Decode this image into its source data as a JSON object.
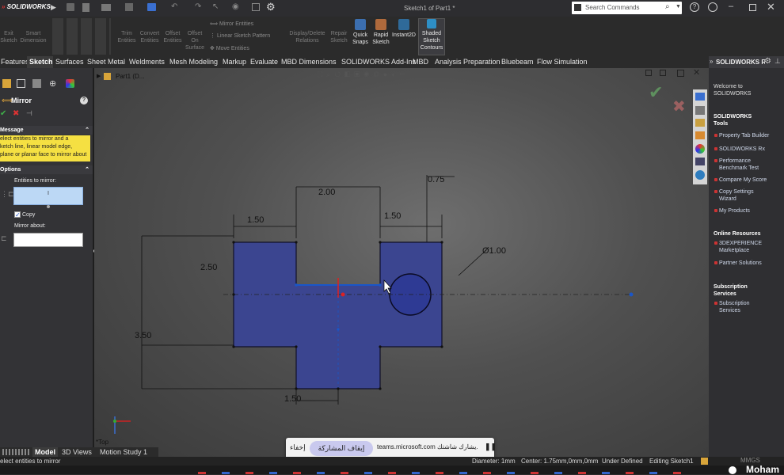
{
  "app": {
    "logo": "SOLIDWORKS",
    "doc_title": "Sketch1 of Part1 *"
  },
  "search": {
    "placeholder": "Search Commands"
  },
  "ribbon": {
    "buttons": [
      {
        "label1": "Exit",
        "label2": "Sketch"
      },
      {
        "label1": "Smart",
        "label2": "Dimension"
      },
      {
        "label1": "Trim",
        "label2": "Entities"
      },
      {
        "label1": "Convert",
        "label2": "Entities"
      },
      {
        "label1": "Offset",
        "label2": "Entities"
      },
      {
        "label1": "Offset",
        "label2": "On",
        "label3": "Surface"
      },
      {
        "label1": "Display/Delete",
        "label2": "Relations"
      },
      {
        "label1": "Repair",
        "label2": "Sketch"
      },
      {
        "label1": "Quick",
        "label2": "Snaps"
      },
      {
        "label1": "Rapid",
        "label2": "Sketch"
      },
      {
        "label1": "Instant2D"
      },
      {
        "label1": "Shaded",
        "label2": "Sketch",
        "label3": "Contours"
      }
    ],
    "mirror_entities": "Mirror Entities",
    "linear_pattern": "Linear Sketch Pattern",
    "move_entities": "Move Entities"
  },
  "tabs": [
    "Features",
    "Sketch",
    "Surfaces",
    "Sheet Metal",
    "Weldments",
    "Mesh Modeling",
    "Markup",
    "Evaluate",
    "MBD Dimensions",
    "SOLIDWORKS Add-Ins",
    "MBD",
    "Analysis Preparation",
    "Bluebeam",
    "Flow Simulation"
  ],
  "tree": {
    "part": "Part1 (D..."
  },
  "propertymanager": {
    "title": "Mirror",
    "message_header": "Message",
    "message": [
      "elect entities to mirror and a",
      "ketch line, linear model edge,",
      "plane or planar face to mirror about"
    ],
    "options_header": "Options",
    "entities_label": "Entities to mirror:",
    "entities_value": "I",
    "copy_label": "Copy",
    "mirror_about_label": "Mirror about:"
  },
  "dimensions": {
    "d200": "2.00",
    "d075": "0.75",
    "d150a": "1.50",
    "d150b": "1.50",
    "d250": "2.50",
    "d350": "3.50",
    "d150c": "1.50",
    "dia": "Ø1.00"
  },
  "view_label": "*Top",
  "taskpane": {
    "header": "SOLIDWORKS Re",
    "welcome": [
      "Welcome to",
      "SOLIDWORKS"
    ],
    "tools_header": [
      "SOLIDWORKS",
      "Tools"
    ],
    "tools": [
      [
        "Property Tab Builder"
      ],
      [
        "SOLIDWORKS Rx"
      ],
      [
        "Performance",
        "Benchmark Test"
      ],
      [
        "Compare My Score"
      ],
      [
        "Copy Settings",
        "Wizard"
      ],
      [
        "My Products"
      ]
    ],
    "online_header": "Online Resources",
    "online": [
      [
        "3DEXPERIENCE",
        "Marketplace"
      ],
      [
        "Partner Solutions"
      ]
    ],
    "sub_header": [
      "Subscription",
      "Services"
    ],
    "sub": [
      [
        "Subscription",
        "Services"
      ]
    ]
  },
  "bottom_tabs": [
    "Model",
    "3D Views",
    "Motion Study 1"
  ],
  "status": {
    "left": "elect entities to mirror",
    "diameter": "Diameter: 1mm",
    "center": "Center: 1.75mm,0mm,0mm",
    "defined": "Under Defined",
    "editing": "Editing Sketch1",
    "units": "MMGS"
  },
  "teams": {
    "hide": "إخفاء",
    "stop": "إيقاف المشاركة",
    "sharing": "teams.microsoft.com يشارك شاشتك."
  },
  "taskbar": {
    "user": "Moham"
  },
  "colors": {
    "sketch_fill": "#3b4590",
    "sketch_edge": "#101028",
    "accent_blue": "#1a56c8",
    "ribbon_lit": "#3c6fb0"
  }
}
